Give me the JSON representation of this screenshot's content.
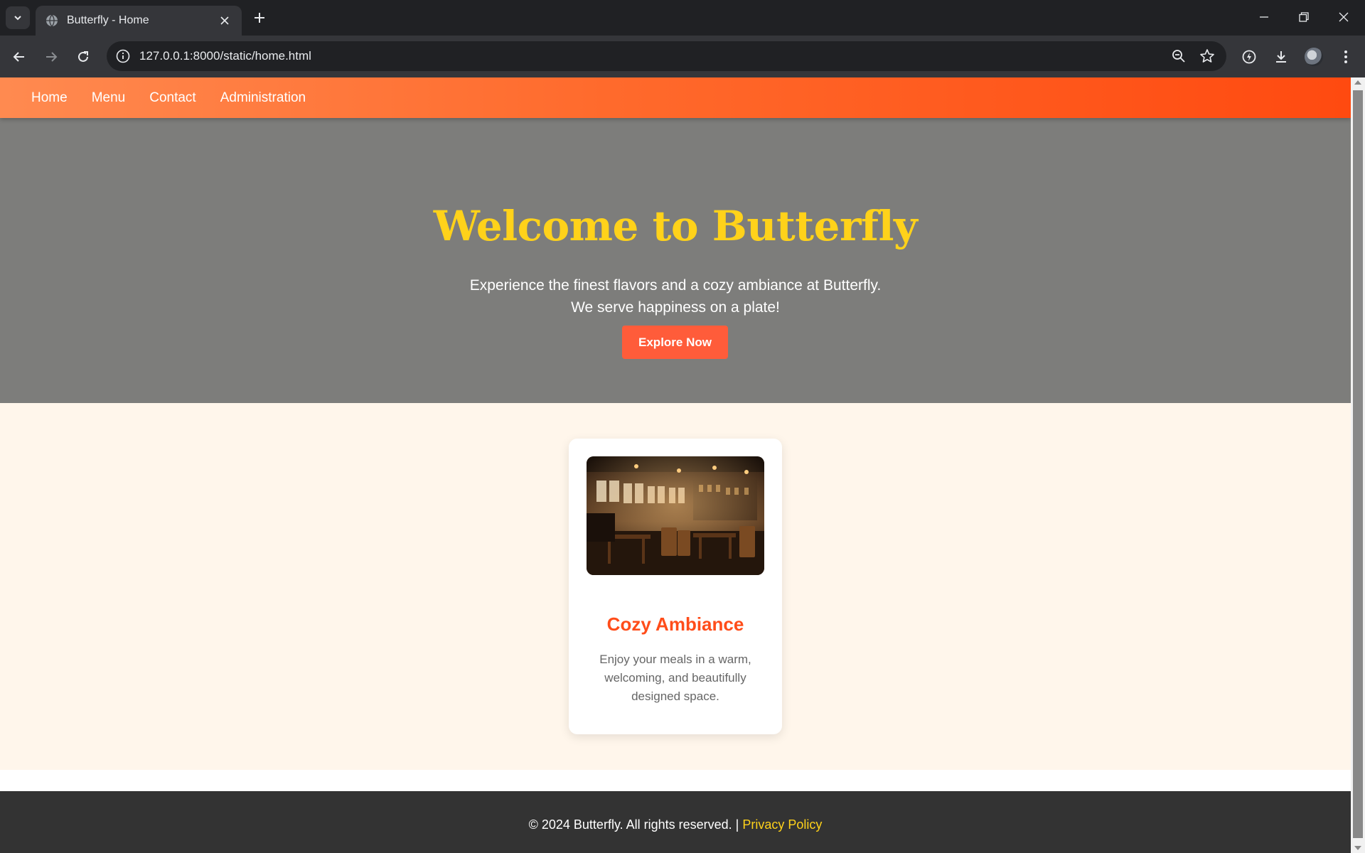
{
  "browser": {
    "tab_title": "Butterfly - Home",
    "url": "127.0.0.1:8000/static/home.html"
  },
  "nav": {
    "items": [
      {
        "label": "Home"
      },
      {
        "label": "Menu"
      },
      {
        "label": "Contact"
      },
      {
        "label": "Administration"
      }
    ]
  },
  "hero": {
    "title": "Welcome to Butterfly",
    "tagline_line1": "Experience the finest flavors and a cozy ambiance at Butterfly.",
    "tagline_line2": "We serve happiness on a plate!",
    "cta_label": "Explore Now"
  },
  "feature_card": {
    "title": "Cozy Ambiance",
    "description": "Enjoy your meals in a warm, welcoming, and beautifully designed space."
  },
  "footer": {
    "copyright": "© 2024 Butterfly. All rights reserved. | ",
    "privacy_label": "Privacy Policy"
  },
  "colors": {
    "nav_gradient_start": "#ff8a50",
    "nav_gradient_end": "#ff4a10",
    "hero_bg": "#7d7d7b",
    "hero_title": "#ffd21a",
    "cta_bg": "#ff5c3a",
    "features_bg": "#fff6eb",
    "card_title": "#ff4d1a",
    "footer_bg": "#333333",
    "footer_link": "#ffd21a"
  }
}
